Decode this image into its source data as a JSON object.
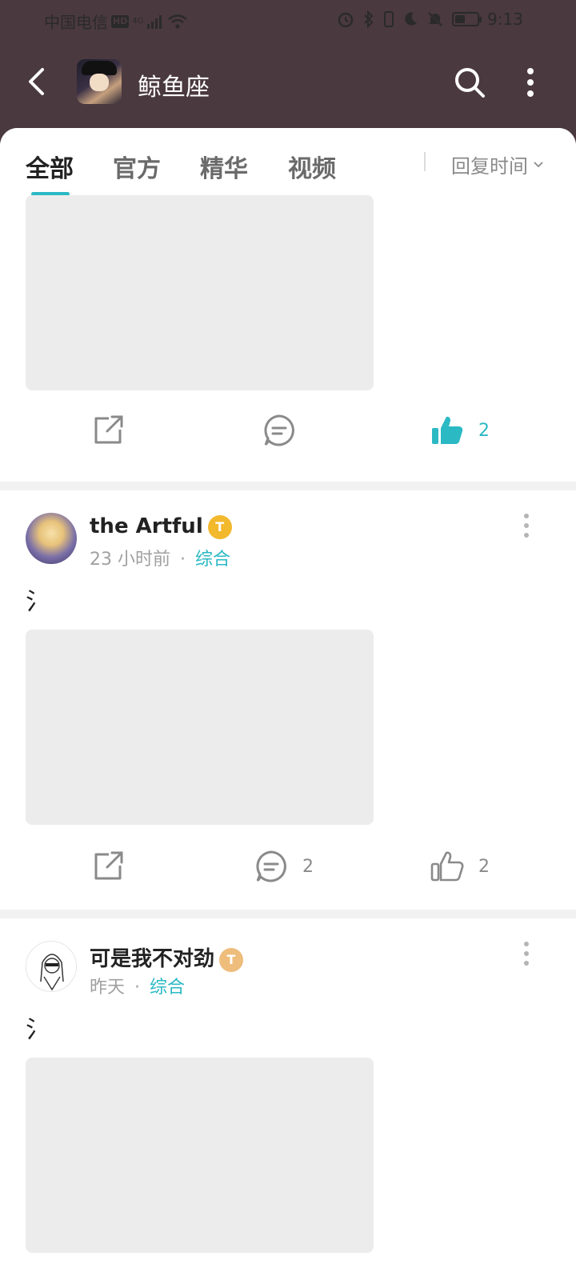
{
  "status_bar": {
    "carrier": "中国电信",
    "hd_badge": "HD",
    "network": "4G",
    "time": "9:13"
  },
  "header": {
    "title": "鲸鱼座",
    "back_icon": "chevron-left-icon",
    "search_icon": "search-icon",
    "more_icon": "more-vertical-icon",
    "background_color": "#4a393f"
  },
  "tabs": [
    {
      "label": "全部",
      "active": true
    },
    {
      "label": "官方",
      "active": false
    },
    {
      "label": "精华",
      "active": false
    },
    {
      "label": "视频",
      "active": false
    }
  ],
  "sort": {
    "label": "回复时间"
  },
  "accent_color": "#2bb9c4",
  "posts": [
    {
      "share_count": "",
      "comment_count": "",
      "like_count": "2",
      "liked": true
    },
    {
      "author": "the Artful",
      "level_badge": "T",
      "time": "23 小时前",
      "separator": "·",
      "category": "综合",
      "text": "氵",
      "share_count": "",
      "comment_count": "2",
      "like_count": "2",
      "liked": false
    },
    {
      "author": "可是我不对劲",
      "level_badge": "T",
      "time": "昨天",
      "separator": "·",
      "category": "综合",
      "text": "氵"
    }
  ]
}
